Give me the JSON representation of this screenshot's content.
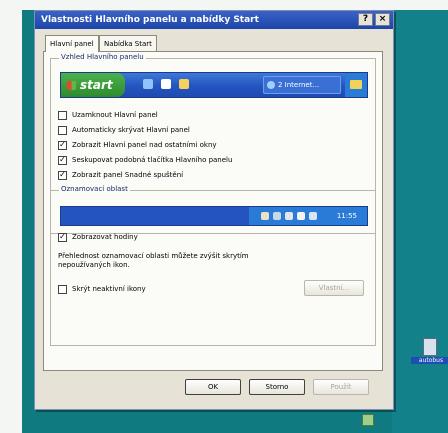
{
  "dialog": {
    "title": "Vlastnosti Hlavního panelu a nabídky Start",
    "help_label": "?",
    "close_label": "×"
  },
  "tabs": [
    {
      "label": "Hlavní panel",
      "active": true
    },
    {
      "label": "Nabídka Start",
      "active": false
    }
  ],
  "taskbar_group": {
    "title": "Vzhled Hlavního panelu",
    "preview": {
      "start_label": "start",
      "task_label": "2 Internet...",
      "colors": {
        "bar": "#2454c0",
        "start": "#3a9a3a",
        "tray": "#2a7ad8"
      }
    },
    "options": [
      {
        "label": "Uzamknout Hlavní panel",
        "checked": false
      },
      {
        "label": "Automaticky skrývat Hlavní panel",
        "checked": false
      },
      {
        "label": "Zobrazit Hlavní panel nad ostatními okny",
        "checked": true
      },
      {
        "label": "Seskupovat podobná tlačítka Hlavního panelu",
        "checked": true
      },
      {
        "label": "Zobrazit panel Snadné spuštění",
        "checked": true
      }
    ]
  },
  "notify_group": {
    "title": "Oznamovací oblast",
    "clock_text": "11:55",
    "show_clock": {
      "label": "Zobrazovat hodiny",
      "checked": true
    },
    "description": "Přehlednost oznamovací oblasti můžete zvýšit skrytím nepoužívaných ikon.",
    "hide_inactive": {
      "label": "Skrýt neaktivní ikony",
      "checked": false
    },
    "customize_label": "Vlastní..."
  },
  "buttons": {
    "ok": "OK",
    "cancel": "Storno",
    "apply": "Použít"
  },
  "desktop": {
    "icon_label": "autobus"
  }
}
